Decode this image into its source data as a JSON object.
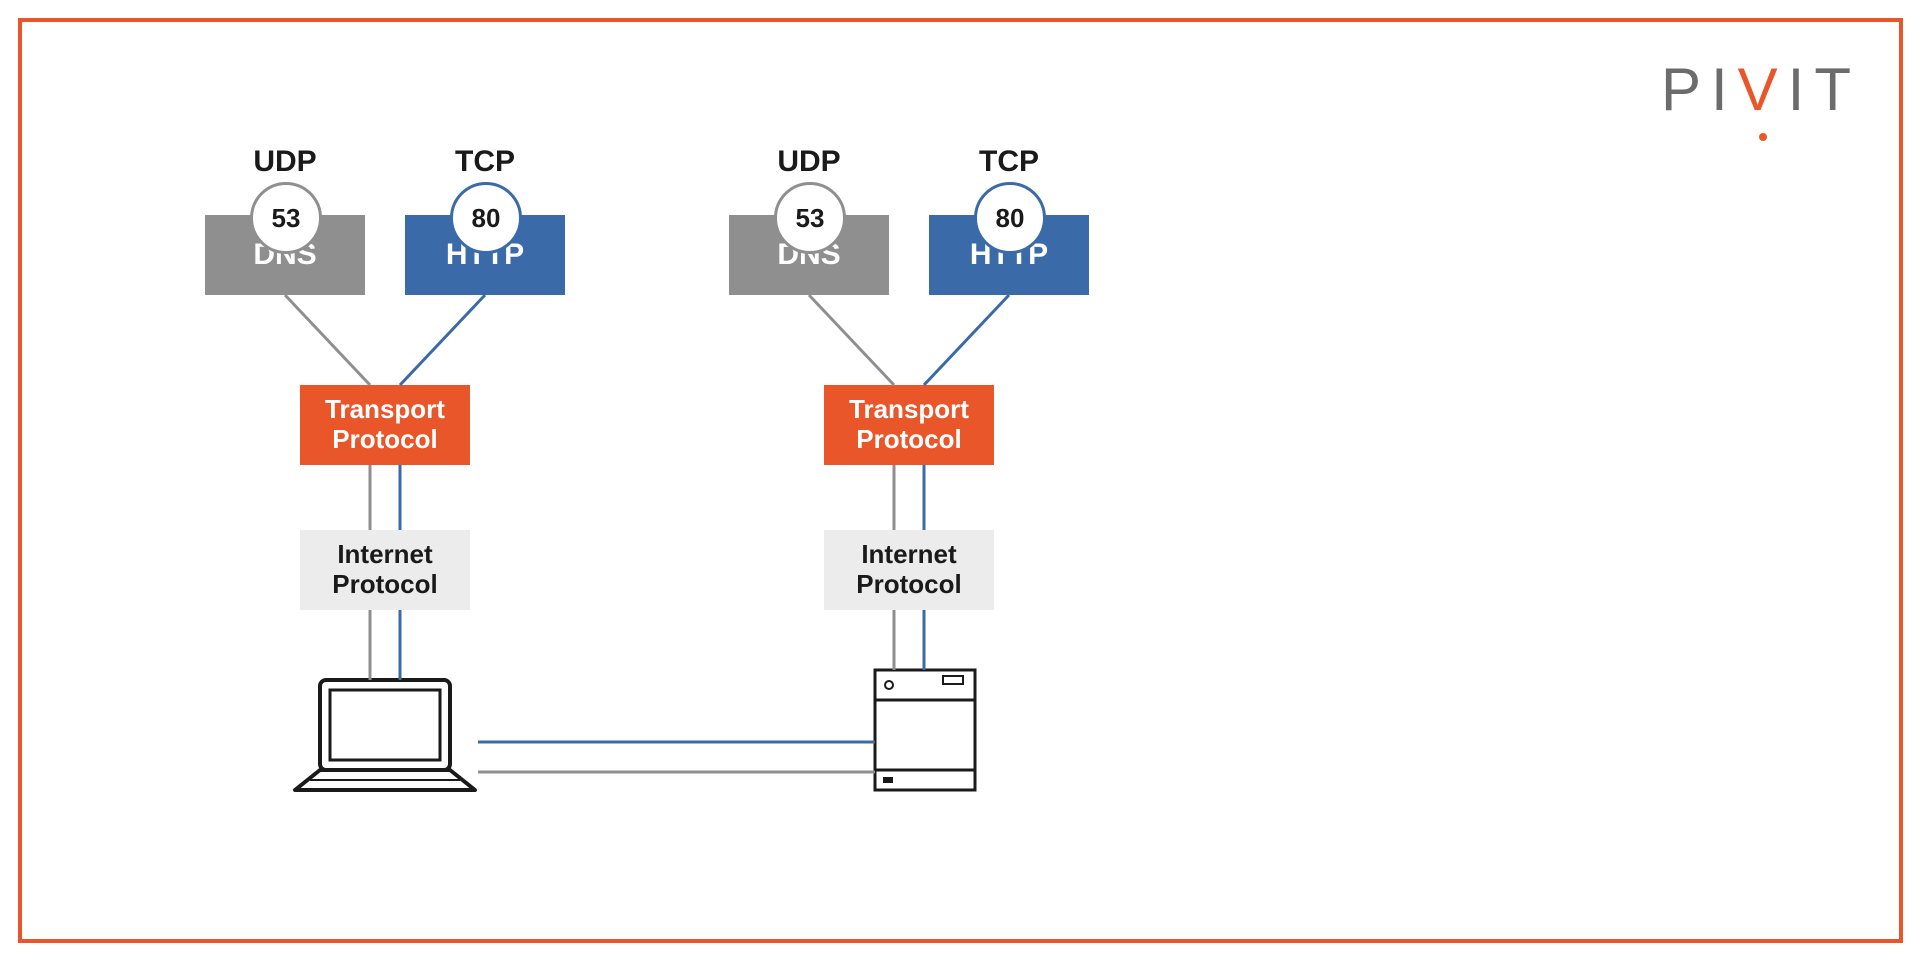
{
  "logo": {
    "text": "PIVIT"
  },
  "left": {
    "udp_label": "UDP",
    "tcp_label": "TCP",
    "dns_port": "53",
    "http_port": "80",
    "dns_name": "DNS",
    "http_name": "HTTP",
    "transport_l1": "Transport",
    "transport_l2": "Protocol",
    "ip_l1": "Internet",
    "ip_l2": "Protocol"
  },
  "right": {
    "udp_label": "UDP",
    "tcp_label": "TCP",
    "dns_port": "53",
    "http_port": "80",
    "dns_name": "DNS",
    "http_name": "HTTP",
    "transport_l1": "Transport",
    "transport_l2": "Protocol",
    "ip_l1": "Internet",
    "ip_l2": "Protocol"
  },
  "colors": {
    "orange": "#e8562a",
    "blue": "#3b6aa8",
    "gray": "#8f8f8f",
    "lightgray": "#ececec"
  }
}
